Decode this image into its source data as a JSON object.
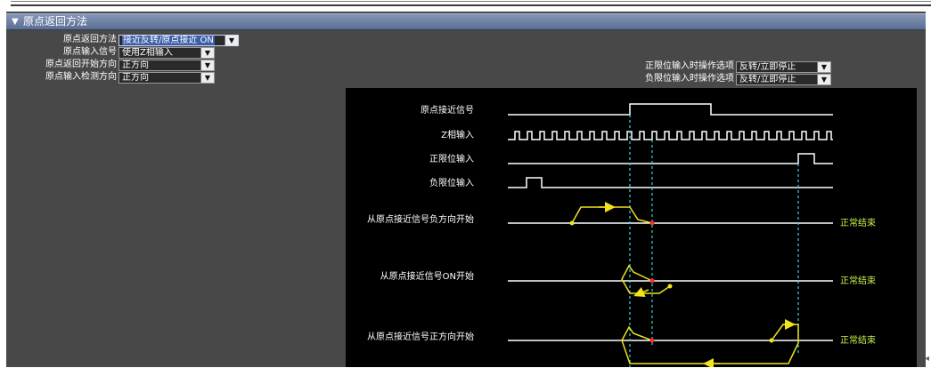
{
  "section": {
    "toggle": "▼",
    "title": "原点返回方法"
  },
  "settings": {
    "method": {
      "label": "原点返回方法",
      "value": "接近反转/原点接近 ON"
    },
    "input_signal": {
      "label": "原点输入信号",
      "value": "使用Z相输入"
    },
    "start_direction": {
      "label": "原点返回开始方向",
      "value": "正方向"
    },
    "detect_direction": {
      "label": "原点输入检测方向",
      "value": "正方向"
    },
    "pos_limit": {
      "label": "正限位输入时操作选项",
      "value": "反转/立即停止"
    },
    "neg_limit": {
      "label": "负限位输入时操作选项",
      "value": "反转/立即停止"
    }
  },
  "dropdown_arrow": "▼",
  "timing": {
    "signals": {
      "proximity": "原点接近信号",
      "z_phase": "Z相输入",
      "pos_limit": "正限位输入",
      "neg_limit": "负限位输入"
    },
    "cases": {
      "neg_start": "从原点接近信号负方向开始",
      "on_start": "从原点接近信号ON开始",
      "pos_start": "从原点接近信号正方向开始"
    },
    "end_label": "正常结束"
  },
  "colors": {
    "panel_bg": "#484848",
    "header_blue": "#5a6d92",
    "path_yellow": "#f0e41e",
    "guide_cyan": "#35d6e0",
    "origin_red": "#ff2a2a",
    "end_green": "#c8f04a"
  }
}
